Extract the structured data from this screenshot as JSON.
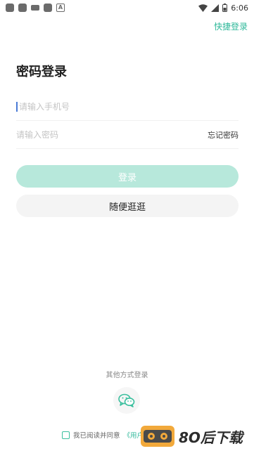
{
  "status_bar": {
    "time": "6:06"
  },
  "header": {
    "quick_login": "快捷登录"
  },
  "title": "密码登录",
  "form": {
    "phone_placeholder": "请输入手机号",
    "password_placeholder": "请输入密码",
    "forgot_password": "忘记密码"
  },
  "buttons": {
    "login": "登录",
    "browse": "随便逛逛"
  },
  "other_login": {
    "label": "其他方式登录",
    "icon": "wechat-icon"
  },
  "agreement": {
    "prefix": "我已阅读并同意",
    "link": "《用户协"
  },
  "watermark": {
    "text": "8O后下载"
  },
  "colors": {
    "accent": "#2fb89a",
    "login_button": "#b7e8db",
    "browse_button": "#f4f4f4"
  }
}
